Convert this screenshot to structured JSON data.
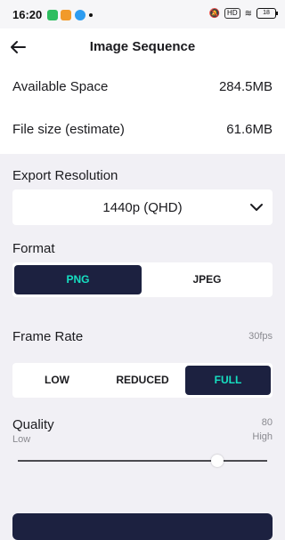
{
  "status_bar": {
    "time": "16:20",
    "network_badge": "HD",
    "battery": "18"
  },
  "header": {
    "title": "Image Sequence"
  },
  "info": {
    "available_space_label": "Available Space",
    "available_space_value": "284.5MB",
    "file_size_label": "File size (estimate)",
    "file_size_value": "61.6MB"
  },
  "export_resolution": {
    "label": "Export Resolution",
    "selected": "1440p (QHD)"
  },
  "format": {
    "label": "Format",
    "options": [
      "PNG",
      "JPEG"
    ],
    "selected": "PNG"
  },
  "frame_rate": {
    "label": "Frame Rate",
    "value": "30fps",
    "options": [
      "LOW",
      "REDUCED",
      "FULL"
    ],
    "selected": "FULL"
  },
  "quality": {
    "label": "Quality",
    "value": "80",
    "min_label": "Low",
    "max_label": "High",
    "level": 0.8
  },
  "colors": {
    "accent_dark": "#1C2140",
    "accent_teal": "#16E0C2",
    "background": "#F1F0F5"
  }
}
